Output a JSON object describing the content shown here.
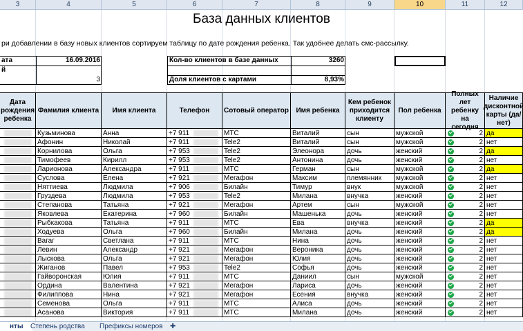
{
  "columns": [
    "3",
    "4",
    "5",
    "6",
    "7",
    "8",
    "9",
    "10",
    "11",
    "12"
  ],
  "title": "База данных клиентов",
  "note": "ри добавлении в базу новых клиентов сортируем таблицу по дате рождения ребенка. Так удобнее делать смс-рассылку.",
  "info": {
    "date_label": "ата",
    "date_value": "16.09.2016",
    "row2_label": "й",
    "row3_value": "3",
    "count_label": "Кол-во клиентов в базе данных",
    "count_value": "3260",
    "share_label": "Доля клиентов с картами",
    "share_value": "8,93%"
  },
  "headers": [
    "Дата рождения ребенка",
    "Фамилия клиента",
    "Имя клиента",
    "Телефон",
    "Сотовый оператор",
    "Имя ребенка",
    "Кем ребенок приходится клиенту",
    "Пол ребенка",
    "Полных лет ребенку на сегодня",
    "Наличие дисконтной карты (да/нет)"
  ],
  "rows": [
    {
      "surname": "Кузьминова",
      "name": "Анна",
      "phone": "+7 911",
      "operator": "МТС",
      "child": "Виталий",
      "relation": "сын",
      "gender": "мужской",
      "age": "2",
      "card": "да"
    },
    {
      "surname": "Афонин",
      "name": "Николай",
      "phone": "+7 911",
      "operator": "Tele2",
      "child": "Виталий",
      "relation": "сын",
      "gender": "мужской",
      "age": "2",
      "card": "нет"
    },
    {
      "surname": "Корнилова",
      "name": "Ольга",
      "phone": "+7 953",
      "operator": "Tele2",
      "child": "Элеонора",
      "relation": "дочь",
      "gender": "женский",
      "age": "2",
      "card": "да"
    },
    {
      "surname": "Тимофеев",
      "name": "Кирилл",
      "phone": "+7 953",
      "operator": "Tele2",
      "child": "Антонина",
      "relation": "дочь",
      "gender": "женский",
      "age": "2",
      "card": "нет"
    },
    {
      "surname": "Ларионова",
      "name": "Александра",
      "phone": "+7 911",
      "operator": "МТС",
      "child": "Герман",
      "relation": "сын",
      "gender": "мужской",
      "age": "2",
      "card": "да"
    },
    {
      "surname": "Суслова",
      "name": "Елена",
      "phone": "+7 921",
      "operator": "Мегафон",
      "child": "Максим",
      "relation": "племянник",
      "gender": "мужской",
      "age": "2",
      "card": "нет"
    },
    {
      "surname": "Няттиева",
      "name": "Людмила",
      "phone": "+7 906",
      "operator": "Билайн",
      "child": "Тимур",
      "relation": "внук",
      "gender": "мужской",
      "age": "2",
      "card": "нет"
    },
    {
      "surname": "Груздева",
      "name": "Людмила",
      "phone": "+7 953",
      "operator": "Tele2",
      "child": "Милана",
      "relation": "внучка",
      "gender": "женский",
      "age": "2",
      "card": "нет"
    },
    {
      "surname": "Степанова",
      "name": "Татьяна",
      "phone": "+7 921",
      "operator": "Мегафон",
      "child": "Артем",
      "relation": "сын",
      "gender": "мужской",
      "age": "2",
      "card": "нет"
    },
    {
      "surname": "Яковлева",
      "name": "Екатерина",
      "phone": "+7 960",
      "operator": "Билайн",
      "child": "Машенька",
      "relation": "дочь",
      "gender": "женский",
      "age": "2",
      "card": "нет"
    },
    {
      "surname": "Рыбкакова",
      "name": "Татьяна",
      "phone": "+7 911",
      "operator": "МТС",
      "child": "Ева",
      "relation": "внучка",
      "gender": "женский",
      "age": "2",
      "card": "да"
    },
    {
      "surname": "Ходуева",
      "name": "Ольга",
      "phone": "+7 960",
      "operator": "Билайн",
      "child": "Милана",
      "relation": "дочь",
      "gender": "женский",
      "age": "2",
      "card": "да"
    },
    {
      "surname": "Вагаг",
      "name": "Светлана",
      "phone": "+7 911",
      "operator": "МТС",
      "child": "Нина",
      "relation": "дочь",
      "gender": "женский",
      "age": "2",
      "card": "нет"
    },
    {
      "surname": "Левин",
      "name": "Александр",
      "phone": "+7 921",
      "operator": "Мегафон",
      "child": "Вероника",
      "relation": "дочь",
      "gender": "женский",
      "age": "2",
      "card": "нет"
    },
    {
      "surname": "Лыскова",
      "name": "Ольга",
      "phone": "+7 921",
      "operator": "Мегафон",
      "child": "Юлия",
      "relation": "дочь",
      "gender": "женский",
      "age": "2",
      "card": "нет"
    },
    {
      "surname": "Жиганов",
      "name": "Павел",
      "phone": "+7 953",
      "operator": "Tele2",
      "child": "Софья",
      "relation": "дочь",
      "gender": "женский",
      "age": "2",
      "card": "нет"
    },
    {
      "surname": "Гайворонская",
      "name": "Юлия",
      "phone": "+7 911",
      "operator": "МТС",
      "child": "Даниил",
      "relation": "сын",
      "gender": "мужской",
      "age": "2",
      "card": "нет"
    },
    {
      "surname": "Ордина",
      "name": "Валентина",
      "phone": "+7 921",
      "operator": "Мегафон",
      "child": "Лариса",
      "relation": "дочь",
      "gender": "женский",
      "age": "2",
      "card": "нет"
    },
    {
      "surname": "Филиппова",
      "name": "Нина",
      "phone": "+7 921",
      "operator": "Мегафон",
      "child": "Есения",
      "relation": "внучка",
      "gender": "женский",
      "age": "2",
      "card": "нет"
    },
    {
      "surname": "Семенова",
      "name": "Ольга",
      "phone": "+7 911",
      "operator": "МТС",
      "child": "Алиса",
      "relation": "дочь",
      "gender": "женский",
      "age": "2",
      "card": "нет"
    },
    {
      "surname": "Асанова",
      "name": "Виктория",
      "phone": "+7 911",
      "operator": "МТС",
      "child": "Милана",
      "relation": "дочь",
      "gender": "женский",
      "age": "2",
      "card": "нет"
    }
  ],
  "sheet_tabs": [
    "нты",
    "Степень родства",
    "Префиксы номеров"
  ],
  "colors": {
    "header_fill": "#dde7f1",
    "yes_fill": "#ffff00",
    "check": "#1fa84a"
  }
}
